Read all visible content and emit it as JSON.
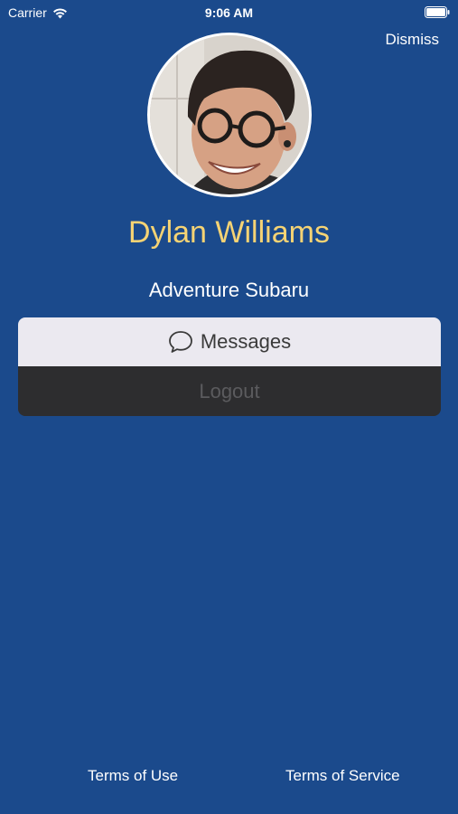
{
  "status_bar": {
    "carrier": "Carrier",
    "time": "9:06 AM",
    "icons": [
      "wifi-icon",
      "battery-icon"
    ]
  },
  "header": {
    "dismiss_label": "Dismiss"
  },
  "profile": {
    "name": "Dylan Williams",
    "dealer": "Adventure Subaru"
  },
  "menu": {
    "messages_label": "Messages",
    "messages_icon": "chat-bubble-icon",
    "logout_label": "Logout"
  },
  "footer": {
    "terms_of_use": "Terms of Use",
    "terms_of_service": "Terms of Service"
  },
  "colors": {
    "background": "#1b4a8c",
    "name_accent": "#f5d374",
    "messages_bg": "#ebe9f0",
    "logout_bg": "#2d2d2f"
  }
}
